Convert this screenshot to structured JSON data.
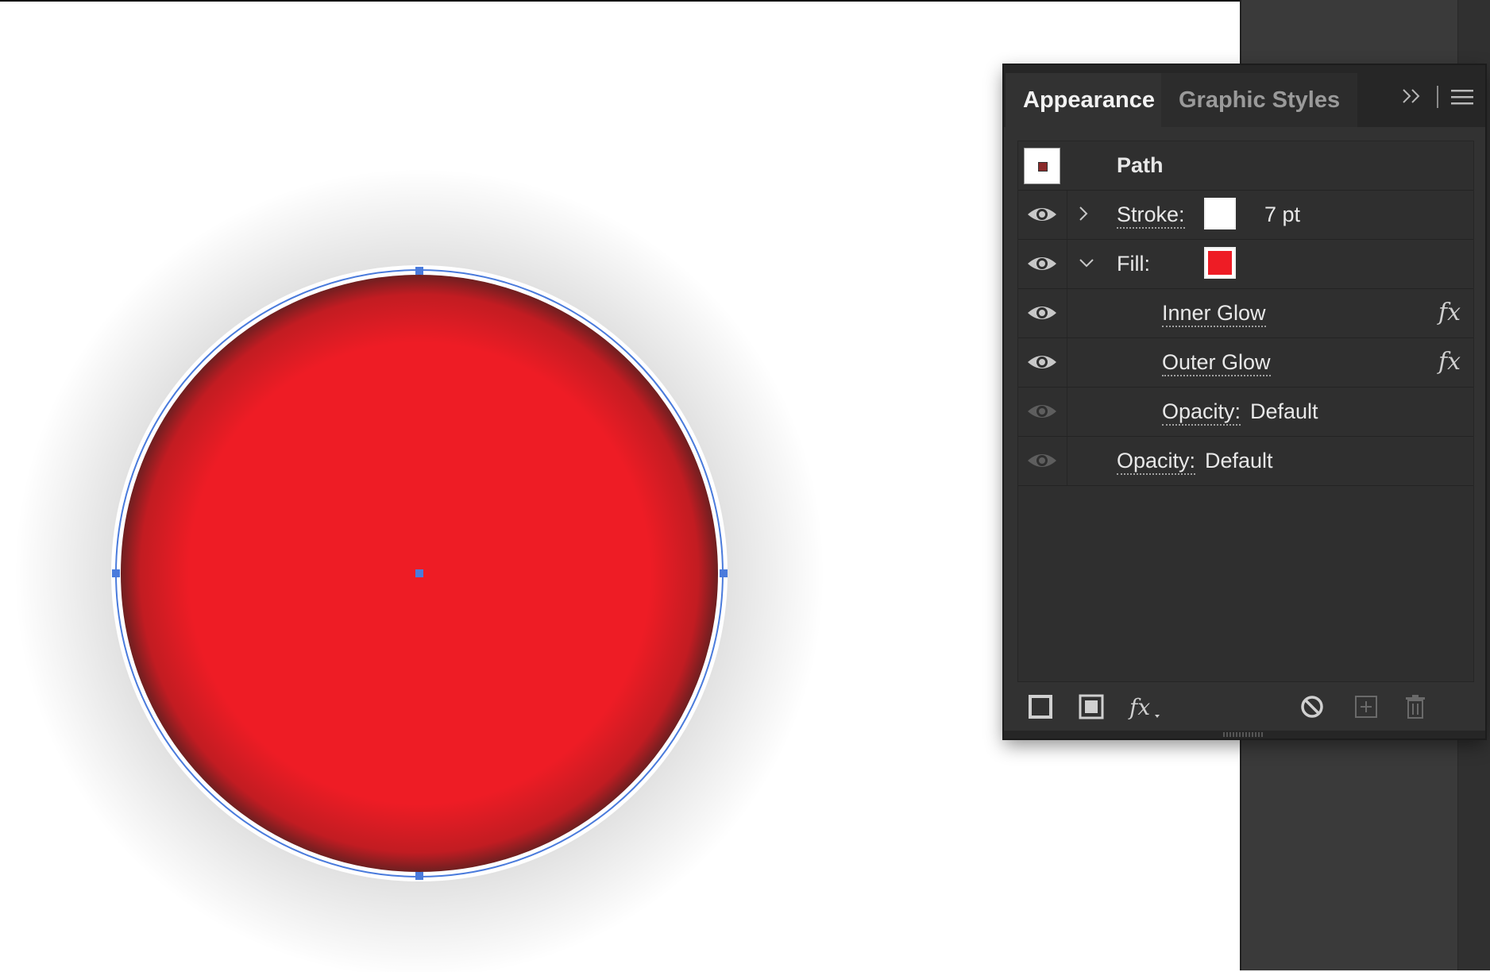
{
  "canvas": {
    "object_type": "circle",
    "fill_color": "#ee1c25",
    "stroke_color": "#ffffff",
    "selection_color": "#4a7bdc"
  },
  "panel": {
    "tabs": [
      {
        "label": "Appearance",
        "active": true
      },
      {
        "label": "Graphic Styles",
        "active": false
      }
    ],
    "header": {
      "title": "Path",
      "thumbnail_icon": "path-thumbnail-icon"
    },
    "rows": {
      "stroke": {
        "label": "Stroke:",
        "value": "7 pt",
        "color": "#ffffff",
        "expanded": false
      },
      "fill": {
        "label": "Fill:",
        "color": "#ee1c25",
        "expanded": true
      },
      "inner_glow": {
        "label": "Inner Glow",
        "fx": "fx"
      },
      "outer_glow": {
        "label": "Outer Glow",
        "fx": "fx"
      },
      "fill_opacity": {
        "label": "Opacity:",
        "value": "Default"
      },
      "opacity": {
        "label": "Opacity:",
        "value": "Default"
      }
    },
    "footer_icons": [
      "add-new-stroke-icon",
      "add-new-fill-icon",
      "add-effect-icon",
      "clear-appearance-icon",
      "duplicate-item-icon",
      "delete-item-icon"
    ],
    "header_icons": [
      "panel-collapse-icon",
      "panel-menu-icon"
    ],
    "colors": {
      "panel_bg": "#323232",
      "tab_bg": "#262626",
      "text": "#e8e8e8"
    }
  }
}
